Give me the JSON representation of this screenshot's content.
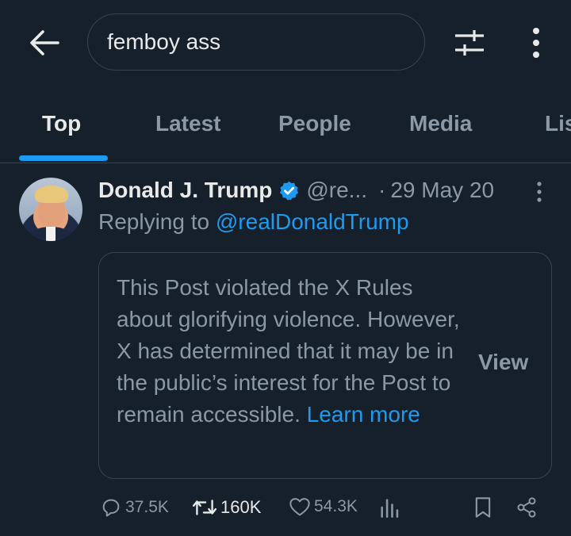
{
  "search": {
    "query": "femboy ass"
  },
  "icons": {
    "back": "arrow-left-icon",
    "filter": "sliders-icon",
    "more": "more-vertical-icon",
    "verified": "verified-badge-icon",
    "reply": "reply-icon",
    "retweet": "retweet-icon",
    "like": "heart-icon",
    "views": "views-chart-icon",
    "bookmark": "bookmark-icon",
    "share": "share-icon"
  },
  "tabs": [
    {
      "label": "Top",
      "active": true
    },
    {
      "label": "Latest",
      "active": false
    },
    {
      "label": "People",
      "active": false
    },
    {
      "label": "Media",
      "active": false
    },
    {
      "label": "Lis",
      "active": false
    }
  ],
  "post": {
    "author_name": "Donald J. Trump",
    "handle": "@re...",
    "separator": "·",
    "timestamp": "29 May 20",
    "replying_prefix": "Replying to ",
    "replying_handle": "@realDonaldTrump",
    "notice": {
      "text": "This Post violated the X Rules about glorifying violence. However, X has determined that it may be in the public’s interest for the Post to remain accessible.",
      "learn_more": "Learn more",
      "view_label": "View"
    },
    "stats": {
      "replies": "37.5K",
      "retweets": "160K",
      "likes": "54.3K"
    }
  },
  "colors": {
    "background": "#15202b",
    "accent": "#1d9bf0",
    "text_primary": "#e7e9ea",
    "text_secondary": "#8b98a5",
    "border": "#38444d"
  }
}
